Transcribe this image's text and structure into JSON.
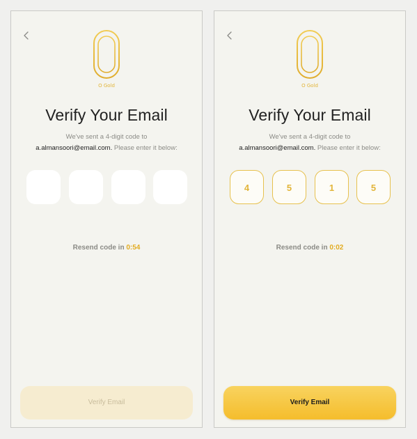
{
  "screens": [
    {
      "state": "empty",
      "brand": "O Gold",
      "title": "Verify Your Email",
      "subtitle_line1": "We've sent a 4-digit code to",
      "email": "a.almansoori@email.com.",
      "subtitle_tail": " Please enter it below:",
      "code_digits": [
        "",
        "",
        "",
        ""
      ],
      "resend_label": "Resend code in ",
      "resend_timer": "0:54",
      "verify_button_label": "Verify Email",
      "verify_button_enabled": false
    },
    {
      "state": "filled",
      "brand": "O Gold",
      "title": "Verify Your Email",
      "subtitle_line1": "We've sent a 4-digit code to",
      "email": "a.almansoori@email.com.",
      "subtitle_tail": " Please enter it below:",
      "code_digits": [
        "4",
        "5",
        "1",
        "5"
      ],
      "resend_label": "Resend code in ",
      "resend_timer": "0:02",
      "verify_button_label": "Verify Email",
      "verify_button_enabled": true
    }
  ],
  "icons": {
    "back": "chevron-left-icon",
    "logo": "o-gold-logo-icon"
  },
  "colors": {
    "gold_accent": "#e2b53a",
    "button_enabled": "#f6c53f",
    "button_disabled": "#f6ecd0",
    "screen_background": "#f4f4ef"
  }
}
